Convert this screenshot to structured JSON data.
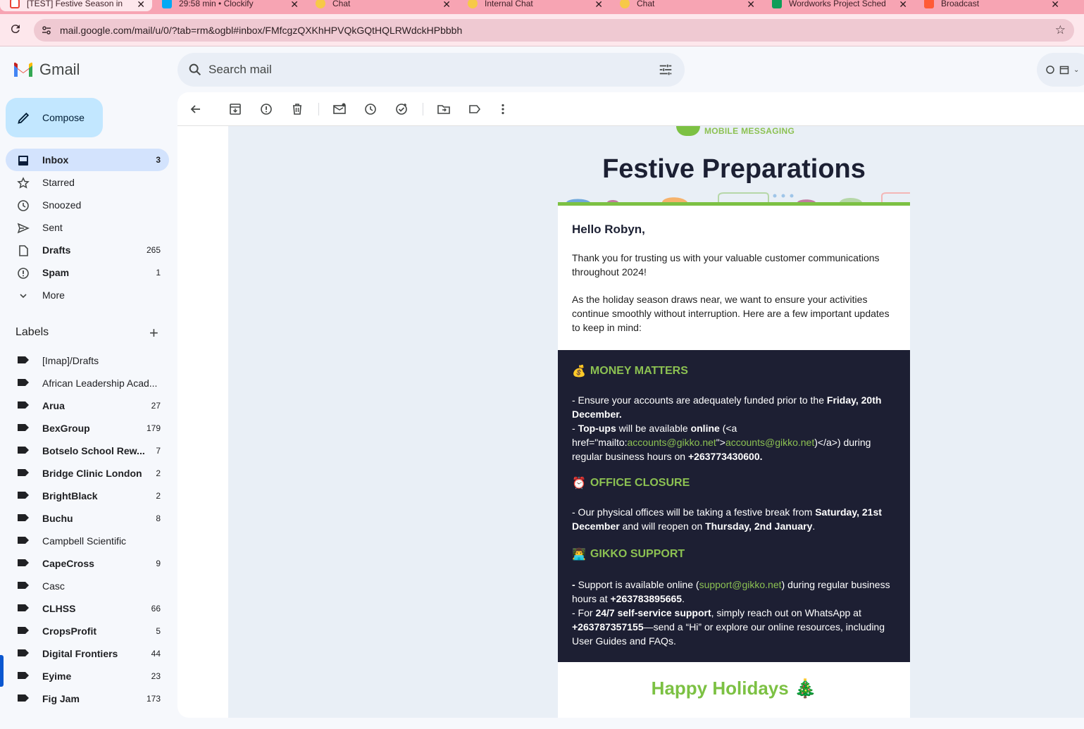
{
  "browser": {
    "tabs": [
      {
        "title": "[TEST] Festive Season in",
        "fav_color": "#ea4335",
        "active": true
      },
      {
        "title": "29:58 min • Clockify",
        "fav_color": "#03a9f4",
        "active": false
      },
      {
        "title": "Chat",
        "fav_color": "#f7c948",
        "active": false
      },
      {
        "title": "Internal Chat",
        "fav_color": "#f7c948",
        "active": false
      },
      {
        "title": "Chat",
        "fav_color": "#f7c948",
        "active": false
      },
      {
        "title": "Wordworks Project Sched",
        "fav_color": "#0f9d58",
        "active": false
      },
      {
        "title": "Broadcast",
        "fav_color": "#ff5a36",
        "active": false
      }
    ],
    "url": "mail.google.com/mail/u/0/?tab=rm&ogbl#inbox/FMfcgzQXKhHPVQkGQtHQLRWdckHPbbbh"
  },
  "app": {
    "name": "Gmail"
  },
  "search": {
    "placeholder": "Search mail"
  },
  "sidebar": {
    "compose_label": "Compose",
    "nav": [
      {
        "label": "Inbox",
        "count": "3",
        "icon": "inbox-icon",
        "active": true
      },
      {
        "label": "Starred",
        "count": "",
        "icon": "star-icon"
      },
      {
        "label": "Snoozed",
        "count": "",
        "icon": "clock-icon"
      },
      {
        "label": "Sent",
        "count": "",
        "icon": "send-icon"
      },
      {
        "label": "Drafts",
        "count": "265",
        "icon": "draft-icon",
        "bold": true
      },
      {
        "label": "Spam",
        "count": "1",
        "icon": "spam-icon",
        "bold": true
      },
      {
        "label": "More",
        "count": "",
        "icon": "chevron-down-icon"
      }
    ],
    "labels_title": "Labels",
    "labels": [
      {
        "label": "[Imap]/Drafts",
        "count": "",
        "bold": false
      },
      {
        "label": "African Leadership Acad...",
        "count": "",
        "bold": false
      },
      {
        "label": "Arua",
        "count": "27",
        "bold": true
      },
      {
        "label": "BexGroup",
        "count": "179",
        "bold": true
      },
      {
        "label": "Botselo School Rew...",
        "count": "7",
        "bold": true
      },
      {
        "label": "Bridge Clinic London",
        "count": "2",
        "bold": true
      },
      {
        "label": "BrightBlack",
        "count": "2",
        "bold": true
      },
      {
        "label": "Buchu",
        "count": "8",
        "bold": true
      },
      {
        "label": "Campbell Scientific",
        "count": "",
        "bold": false
      },
      {
        "label": "CapeCross",
        "count": "9",
        "bold": true
      },
      {
        "label": "Casc",
        "count": "",
        "bold": false
      },
      {
        "label": "CLHSS",
        "count": "66",
        "bold": true
      },
      {
        "label": "CropsProfit",
        "count": "5",
        "bold": true
      },
      {
        "label": "Digital Frontiers",
        "count": "44",
        "bold": true
      },
      {
        "label": "Eyime",
        "count": "23",
        "bold": true
      },
      {
        "label": "Fig Jam",
        "count": "173",
        "bold": true
      }
    ]
  },
  "toolbar": {
    "icons": [
      "back-arrow-icon",
      "archive-icon",
      "report-spam-icon",
      "delete-icon",
      "mark-unread-icon",
      "snooze-icon",
      "add-task-icon",
      "move-to-icon",
      "label-icon",
      "more-vert-icon"
    ]
  },
  "email": {
    "brand_text": "MOBILE MESSAGING",
    "hero_title": "Festive Preparations",
    "greeting": "Hello Robyn,",
    "para1": "Thank you for trusting us with your valuable customer communications throughout 2024!",
    "para2": "As the holiday season draws near, we want to ensure your activities continue smoothly without interruption. Here are a few important updates to keep in mind:",
    "money": {
      "emoji": "💰",
      "title": "MONEY MATTERS",
      "l1a": "- Ensure your accounts are adequately funded prior to the ",
      "l1b": "Friday, 20th December.",
      "l2a": "- ",
      "l2b": "Top-ups",
      "l2c": " will be available ",
      "l2d": "online",
      "l2e": " (<a href=\"mailto:",
      "l2f": "accounts@gikko.net",
      "l2g": "\">",
      "l2h": "accounts@gikko.net",
      "l2i": ")</a>) during regular business hours on ",
      "l2j": "+263773430600."
    },
    "office": {
      "emoji": "⏰",
      "title": "OFFICE CLOSURE",
      "a": "- Our physical offices will be taking a festive break from ",
      "b": "Saturday, 21st December",
      "c": " and will reopen on ",
      "d": "Thursday, 2nd January",
      "e": "."
    },
    "support": {
      "emoji": "👨‍💻",
      "title": "GIKKO SUPPORT",
      "a": "- ",
      "b": "Support is available online (",
      "c": "support@gikko.net",
      "d": ") during regular business hours at ",
      "e": "+263783895665",
      "f": ".",
      "g": "- For ",
      "h": "24/7 self-service support",
      "i": ", simply reach out on WhatsApp at ",
      "j": "+263787357155",
      "k": "—send a “Hi” or explore our online resources, including User Guides and FAQs."
    },
    "holidays_title": "Happy Holidays 🎄"
  },
  "colors": {
    "accent_green": "#8cc152",
    "dark_panel": "#1d1f33",
    "active_nav": "#d3e3fd",
    "compose_bg": "#c2e7ff"
  }
}
